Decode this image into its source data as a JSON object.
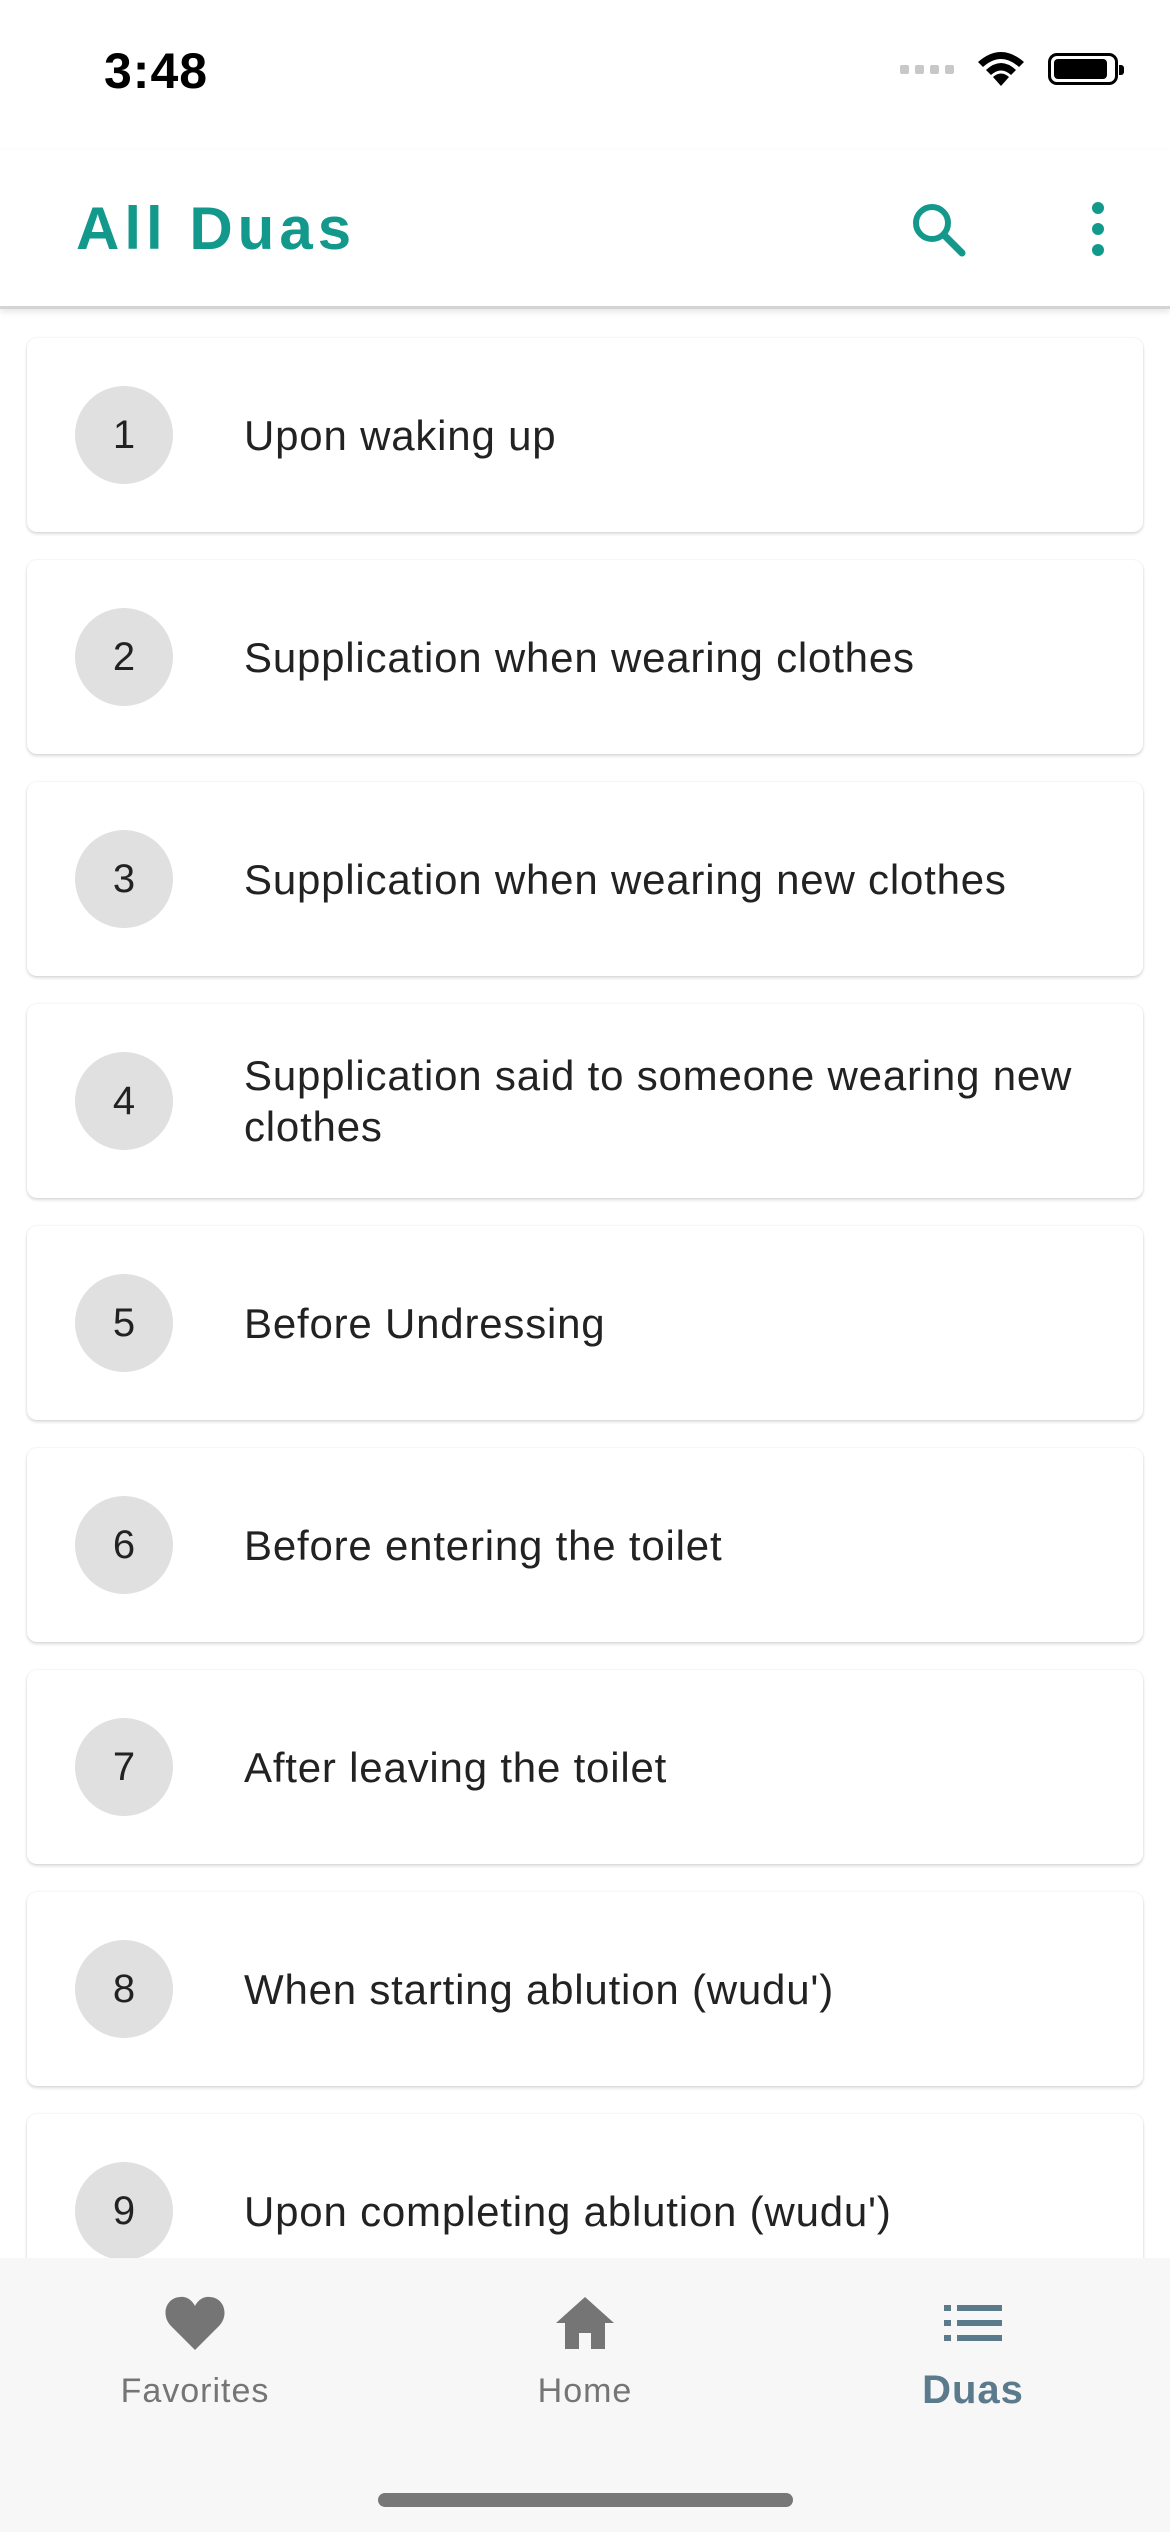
{
  "status_bar": {
    "time": "3:48"
  },
  "app_bar": {
    "title": "All Duas",
    "search_icon": "search-icon",
    "more_icon": "more-vertical-icon",
    "accent_color": "#13998b"
  },
  "duas": [
    {
      "number": "1",
      "title": "Upon waking up"
    },
    {
      "number": "2",
      "title": "Supplication when wearing clothes"
    },
    {
      "number": "3",
      "title": "Supplication when wearing new clothes"
    },
    {
      "number": "4",
      "title": "Supplication said to someone wearing new clothes"
    },
    {
      "number": "5",
      "title": "Before Undressing"
    },
    {
      "number": "6",
      "title": "Before entering the toilet"
    },
    {
      "number": "7",
      "title": "After leaving the toilet"
    },
    {
      "number": "8",
      "title": "When starting ablution (wudu')"
    },
    {
      "number": "9",
      "title": "Upon completing ablution (wudu')"
    }
  ],
  "bottom_nav": {
    "items": [
      {
        "label": "Favorites",
        "icon": "heart-icon",
        "active": false
      },
      {
        "label": "Home",
        "icon": "home-icon",
        "active": false
      },
      {
        "label": "Duas",
        "icon": "list-icon",
        "active": true
      }
    ],
    "active_color": "#5b7a8c"
  }
}
